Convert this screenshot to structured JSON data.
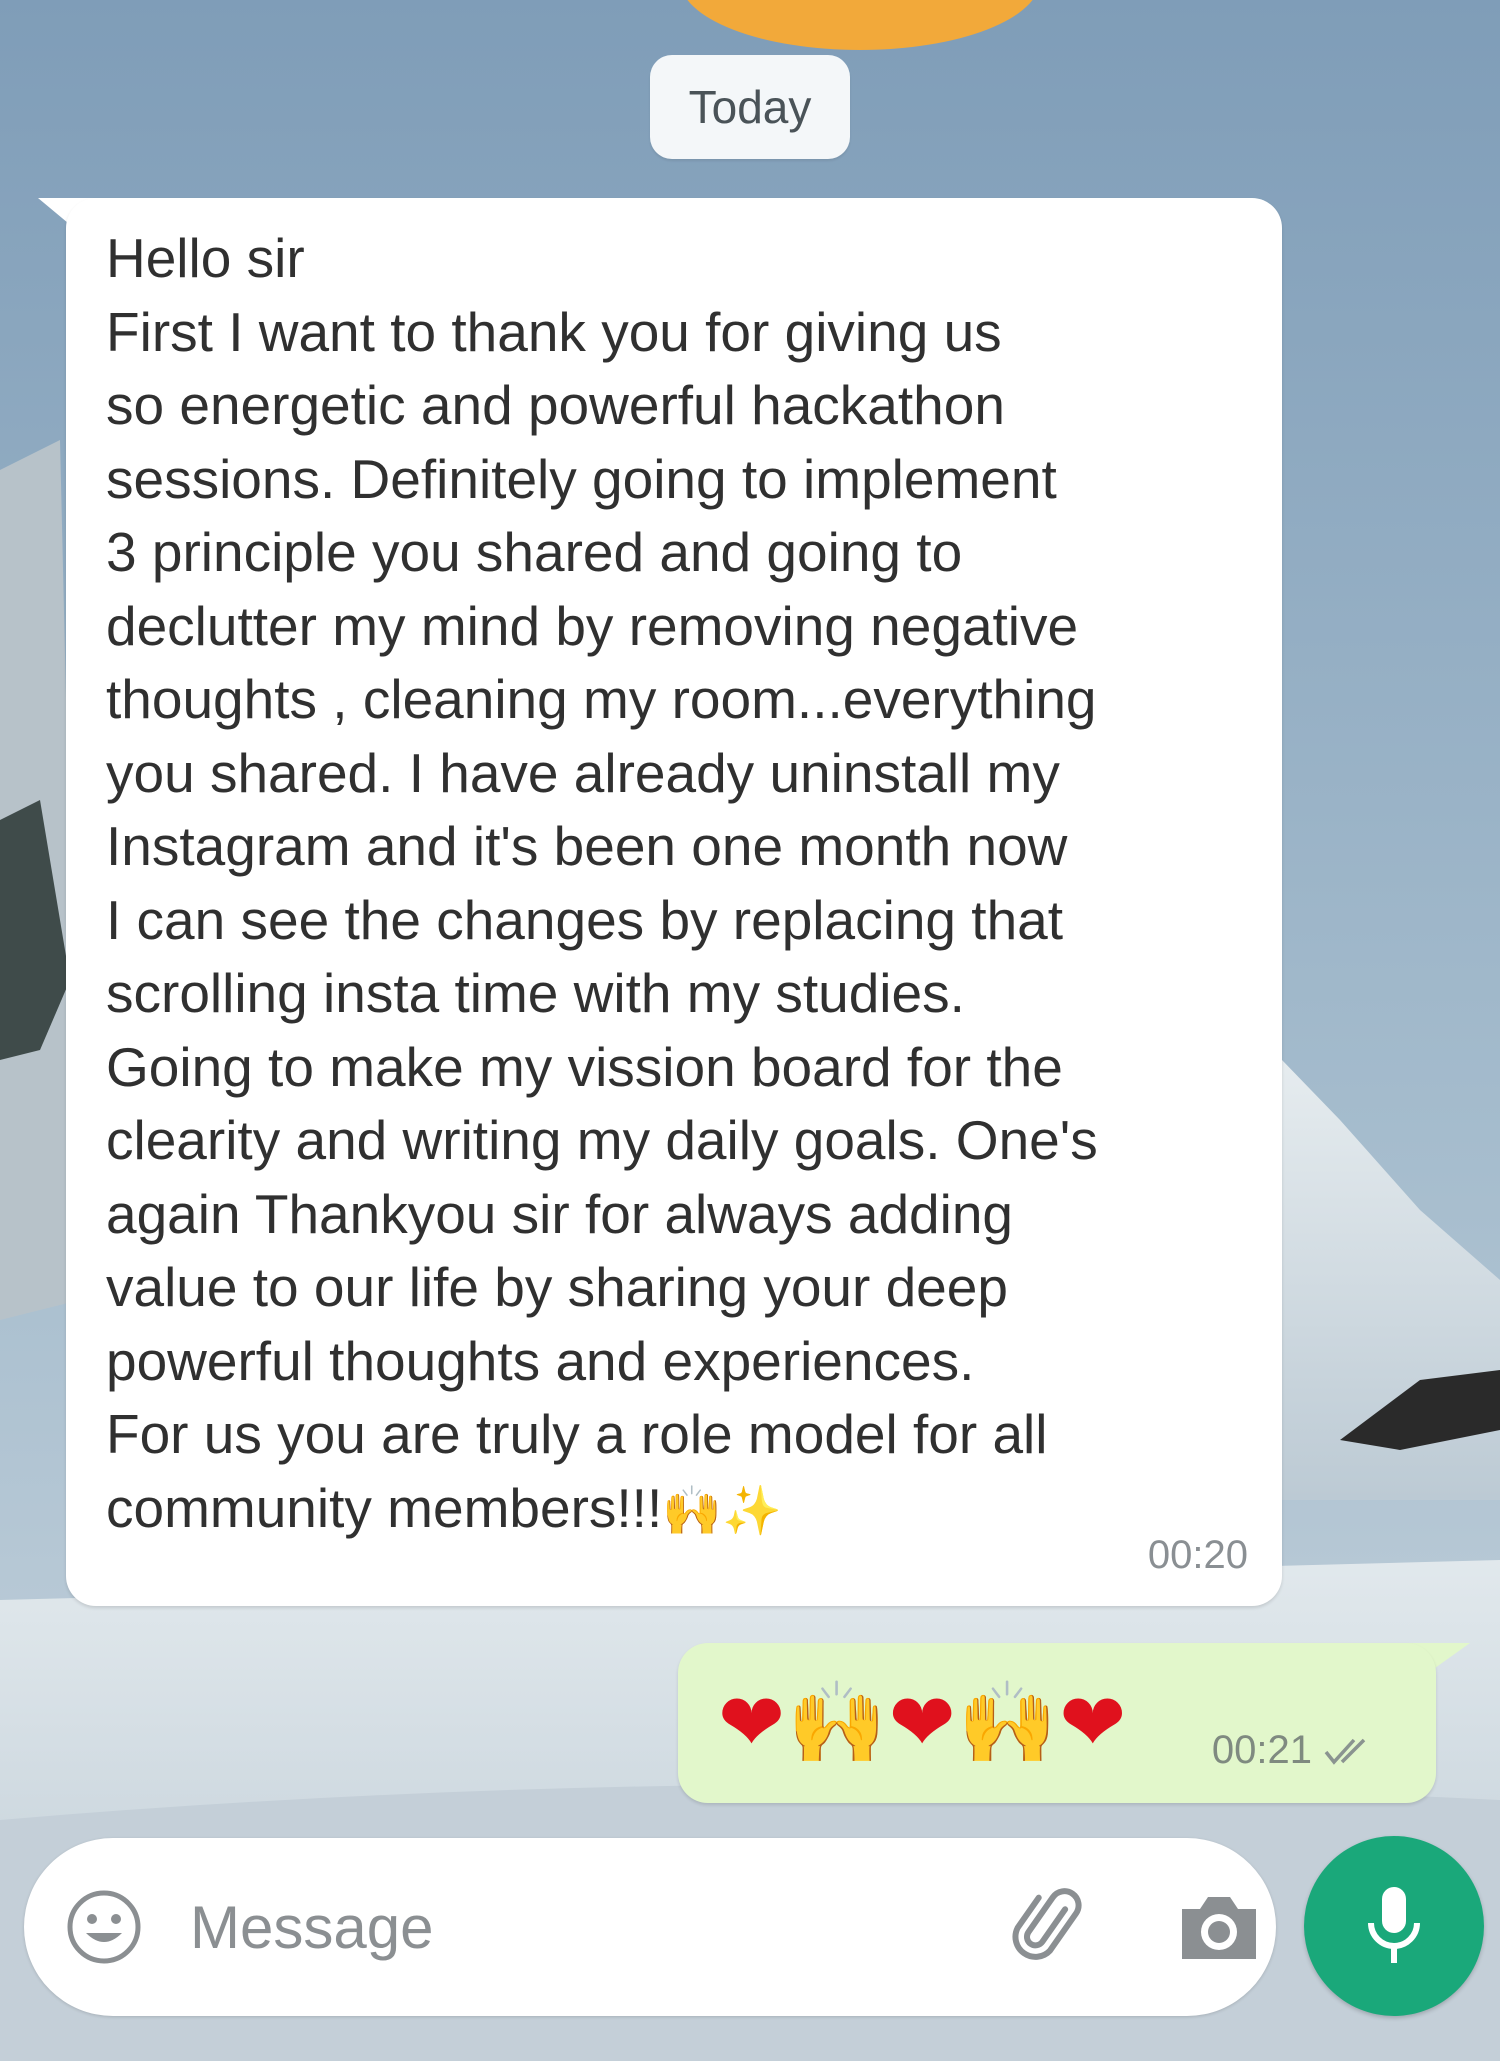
{
  "chat": {
    "date_chip": "Today",
    "incoming": {
      "text": "Hello sir\nFirst I want to thank you for giving us\nso energetic and powerful hackathon\nsessions. Definitely going to implement\n3 principle you shared and going to\ndeclutter my mind by removing negative\nthoughts , cleaning my room...everything\nyou shared. I have already uninstall my\nInstagram and it's been one month now\nI can see the changes by replacing that\nscrolling insta time with my studies.\nGoing to make my vission board for the\nclearity and writing my daily goals. One's\nagain Thankyou sir for always adding\nvalue to our life by sharing your deep\npowerful thoughts and experiences.\nFor us you are truly a role model for all\ncommunity members!!!",
      "trailing_emojis": "🙌✨",
      "time": "00:20"
    },
    "outgoing": {
      "emojis": [
        "❤",
        "🙌",
        "❤",
        "🙌",
        "❤"
      ],
      "time": "00:21",
      "status_icon": "double-check-icon"
    }
  },
  "composer": {
    "placeholder": "Message",
    "value": "",
    "icons": {
      "emoji": "smiley-icon",
      "attach": "paperclip-icon",
      "camera": "camera-icon",
      "send": "microphone-icon"
    }
  },
  "colors": {
    "incoming_bubble": "#ffffff",
    "outgoing_bubble": "#e2f7cb",
    "mic_button": "#1aa87a",
    "heart": "#e0111d"
  }
}
